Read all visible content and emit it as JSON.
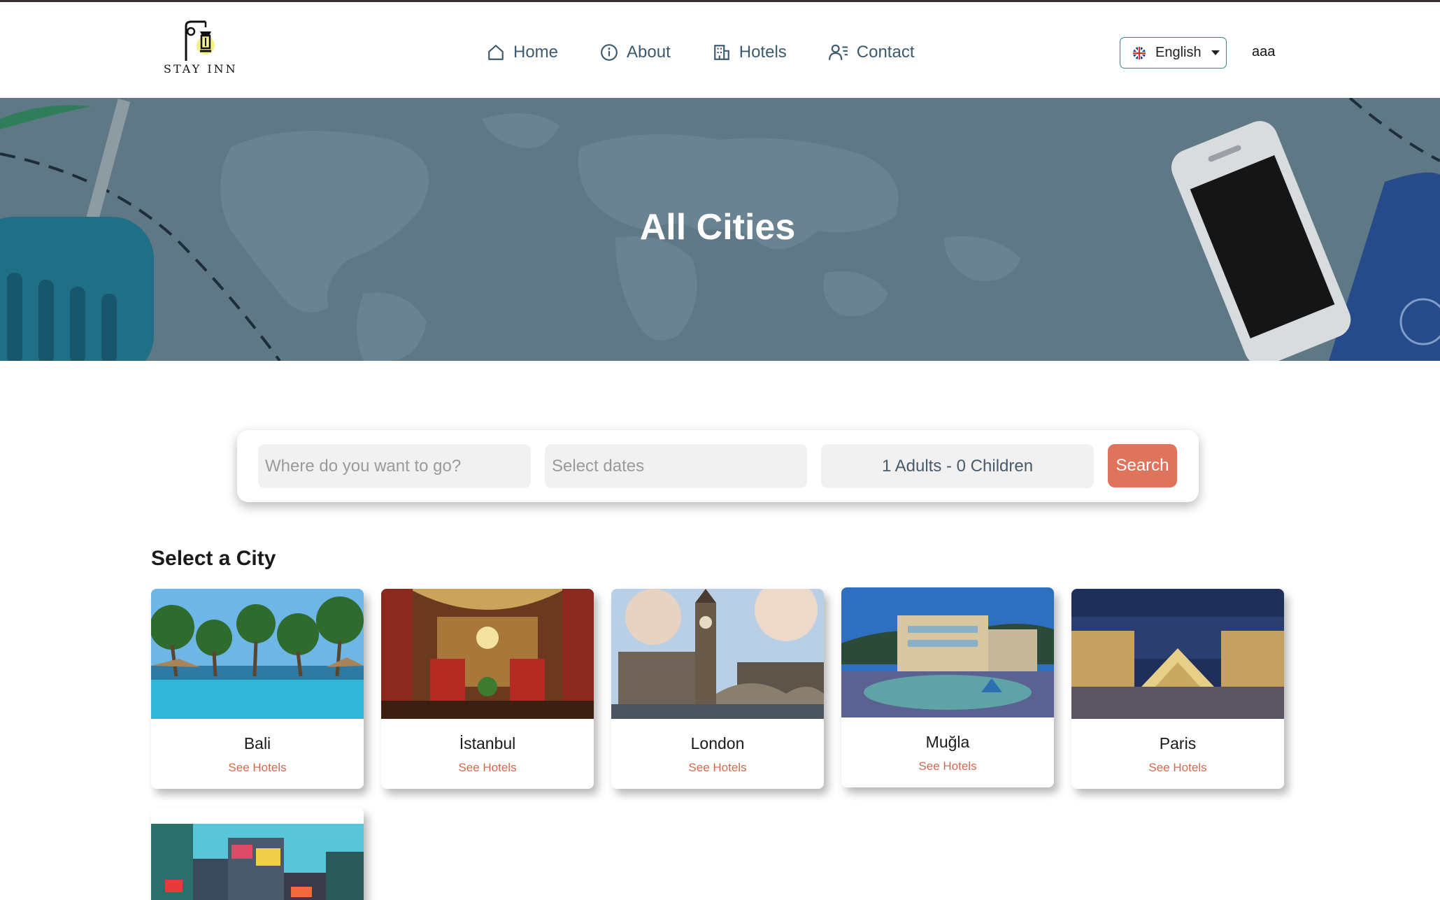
{
  "brand": {
    "logo_text": "STAY INN"
  },
  "nav": {
    "home": "Home",
    "about": "About",
    "hotels": "Hotels",
    "contact": "Contact"
  },
  "language": {
    "selected": "English",
    "icon": "uk-flag-icon"
  },
  "user": {
    "name": "aaa"
  },
  "hero": {
    "title": "All Cities"
  },
  "search": {
    "destination_placeholder": "Where do you want to go?",
    "dates_placeholder": "Select dates",
    "guests_value": "1 Adults - 0 Children",
    "button_label": "Search"
  },
  "cities_section": {
    "title": "Select a City",
    "cities": [
      {
        "name": "Bali",
        "link": "See Hotels"
      },
      {
        "name": "İstanbul",
        "link": "See Hotels"
      },
      {
        "name": "London",
        "link": "See Hotels"
      },
      {
        "name": "Muğla",
        "link": "See Hotels"
      },
      {
        "name": "Paris",
        "link": "See Hotels"
      }
    ]
  },
  "colors": {
    "accent": "#e0735b",
    "nav_text": "#3d5a6e",
    "hero_overlay": "#5f7886",
    "lang_border": "#2f8a8a"
  }
}
